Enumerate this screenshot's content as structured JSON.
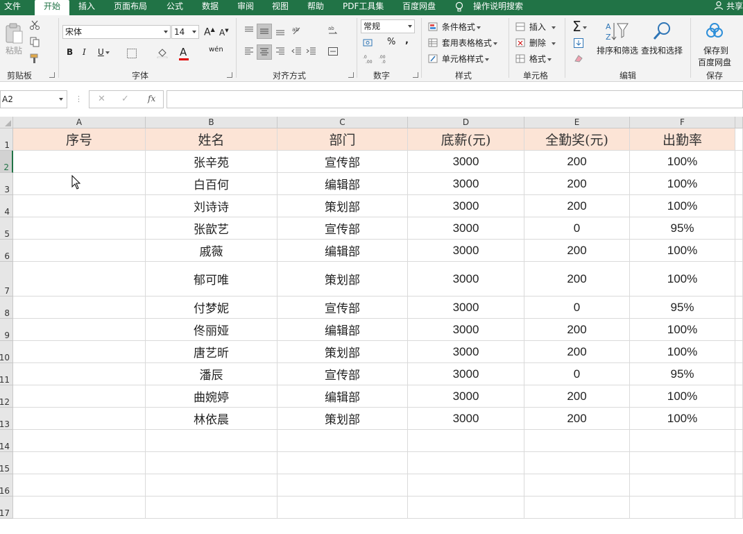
{
  "tabs": [
    {
      "label": "文件",
      "active": false
    },
    {
      "label": "开始",
      "active": true
    },
    {
      "label": "插入",
      "active": false
    },
    {
      "label": "页面布局",
      "active": false
    },
    {
      "label": "公式",
      "active": false
    },
    {
      "label": "数据",
      "active": false
    },
    {
      "label": "审阅",
      "active": false
    },
    {
      "label": "视图",
      "active": false
    },
    {
      "label": "帮助",
      "active": false
    },
    {
      "label": "PDF工具集",
      "active": false
    },
    {
      "label": "百度网盘",
      "active": false
    }
  ],
  "tell_me": "操作说明搜索",
  "share": "共享",
  "ribbon": {
    "clipboard": {
      "paste": "粘贴",
      "group": "剪贴板"
    },
    "font": {
      "name": "宋体",
      "size": "14",
      "group": "字体",
      "bold": "B",
      "italic": "I",
      "underline": "U",
      "fontcolor_glyph": "A",
      "phonetic": "wén"
    },
    "alignment": {
      "group": "对齐方式"
    },
    "number": {
      "format": "常规",
      "percent": "%",
      "comma": ",",
      "group": "数字"
    },
    "styles": {
      "conditional": "条件格式",
      "table": "套用表格格式",
      "cell": "单元格样式",
      "group": "样式"
    },
    "cells": {
      "insert": "插入",
      "delete": "删除",
      "format": "格式",
      "group": "单元格"
    },
    "editing": {
      "sort": "排序和筛选",
      "find": "查找和选择",
      "group": "编辑"
    },
    "save": {
      "label_line1": "保存到",
      "label_line2": "百度网盘",
      "group": "保存"
    }
  },
  "formula_bar": {
    "name_box": "A2",
    "cancel": "✕",
    "enter": "✓",
    "fx": "fx",
    "value": ""
  },
  "columns": [
    "A",
    "B",
    "C",
    "D",
    "E",
    "F"
  ],
  "row_numbers": [
    "1",
    "2",
    "3",
    "4",
    "5",
    "6",
    "7",
    "8",
    "9",
    "10",
    "11",
    "12",
    "13",
    "14",
    "15",
    "16",
    "17"
  ],
  "selected_row": "2",
  "sheet": {
    "header": [
      "序号",
      "姓名",
      "部门",
      "底薪(元)",
      "全勤奖(元)",
      "出勤率"
    ],
    "rows": [
      [
        "",
        "张辛苑",
        "宣传部",
        "3000",
        "200",
        "100%"
      ],
      [
        "",
        "白百何",
        "编辑部",
        "3000",
        "200",
        "100%"
      ],
      [
        "",
        "刘诗诗",
        "策划部",
        "3000",
        "200",
        "100%"
      ],
      [
        "",
        "张歆艺",
        "宣传部",
        "3000",
        "0",
        "95%"
      ],
      [
        "",
        "戚薇",
        "编辑部",
        "3000",
        "200",
        "100%"
      ],
      [
        "",
        "郁可唯",
        "策划部",
        "3000",
        "200",
        "100%"
      ],
      [
        "",
        "付梦妮",
        "宣传部",
        "3000",
        "0",
        "95%"
      ],
      [
        "",
        "佟丽娅",
        "编辑部",
        "3000",
        "200",
        "100%"
      ],
      [
        "",
        "唐艺昕",
        "策划部",
        "3000",
        "200",
        "100%"
      ],
      [
        "",
        "潘辰",
        "宣传部",
        "3000",
        "0",
        "95%"
      ],
      [
        "",
        "曲婉婷",
        "编辑部",
        "3000",
        "200",
        "100%"
      ],
      [
        "",
        "林依晨",
        "策划部",
        "3000",
        "200",
        "100%"
      ]
    ]
  },
  "colors": {
    "accent": "#217346",
    "header_fill": "#fce4d6"
  }
}
